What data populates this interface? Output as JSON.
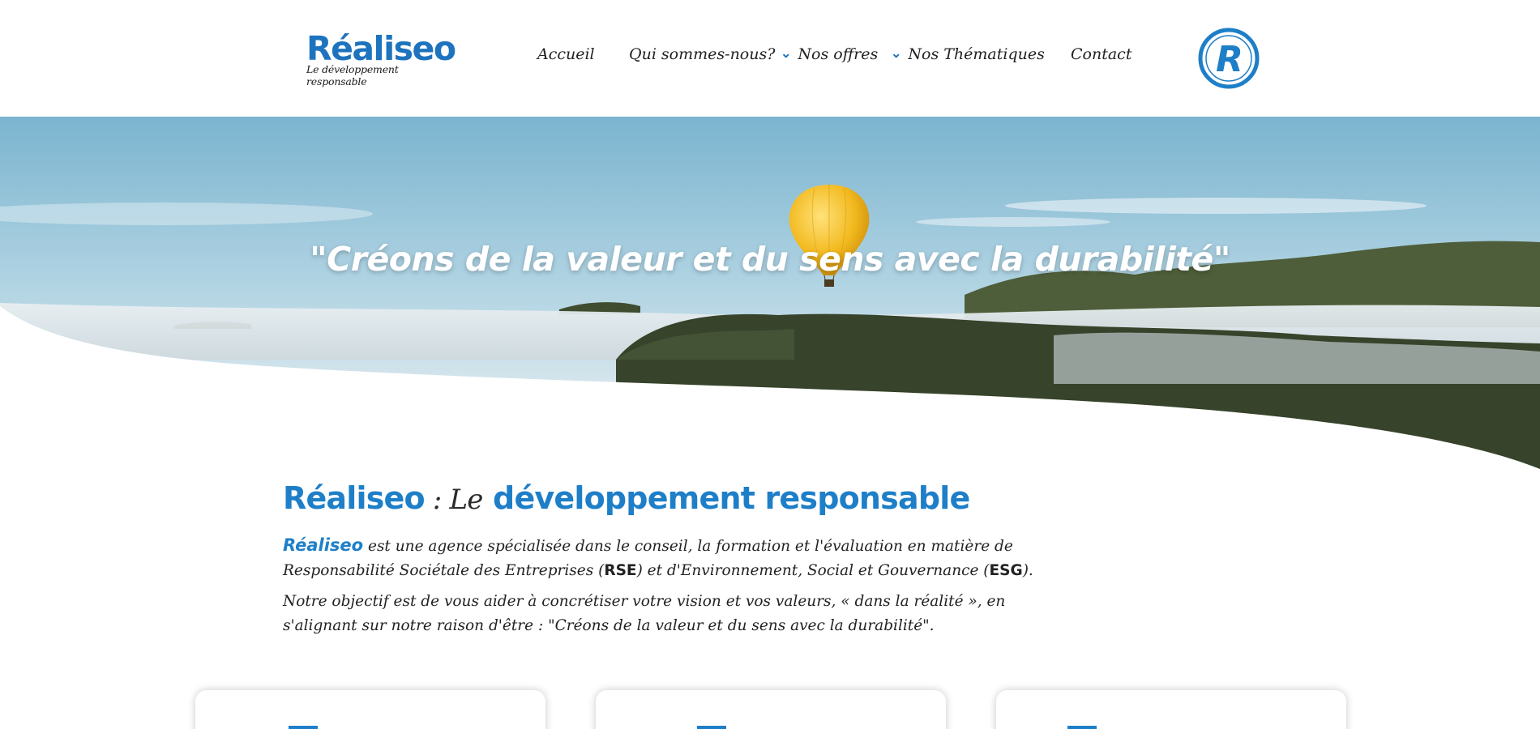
{
  "header": {
    "logo": {
      "name": "Réaliseo",
      "tagline": "Le développement responsable"
    },
    "nav": [
      {
        "label": "Accueil",
        "has_dropdown": false
      },
      {
        "label": "Qui sommes-nous?",
        "has_dropdown": false
      },
      {
        "label": "Nos offres",
        "has_dropdown": true
      },
      {
        "label": "Nos Thématiques",
        "has_dropdown": true
      },
      {
        "label": "Contact",
        "has_dropdown": false
      }
    ],
    "emblem_letter": "R"
  },
  "hero": {
    "quote": "\"Créons de la valeur et du sens avec la durabilité\""
  },
  "intro": {
    "title_brand": "Réaliseo",
    "title_sep": " : ",
    "title_le": "Le",
    "title_rest": "développement responsable",
    "p1_brand": "Réaliseo",
    "p1_text_a": " est une agence spécialisée dans le conseil, la formation et l'évaluation en matière de Responsabilité Sociétale des Entreprises (",
    "p1_rse": "RSE",
    "p1_text_b": ") et d'Environnement, Social et Gouvernance (",
    "p1_esg": "ESG",
    "p1_text_c": ").",
    "p2": "Notre objectif est de vous aider à concrétiser votre vision et vos valeurs, « dans la réalité », en s'alignant sur notre raison d'être : \"Créons de la valeur et du sens avec la durabilité\"."
  },
  "colors": {
    "accent": "#1e7fc8",
    "text": "#222222"
  },
  "icons": {
    "dropdown": "chevron-down-icon",
    "emblem": "r-emblem-icon"
  }
}
